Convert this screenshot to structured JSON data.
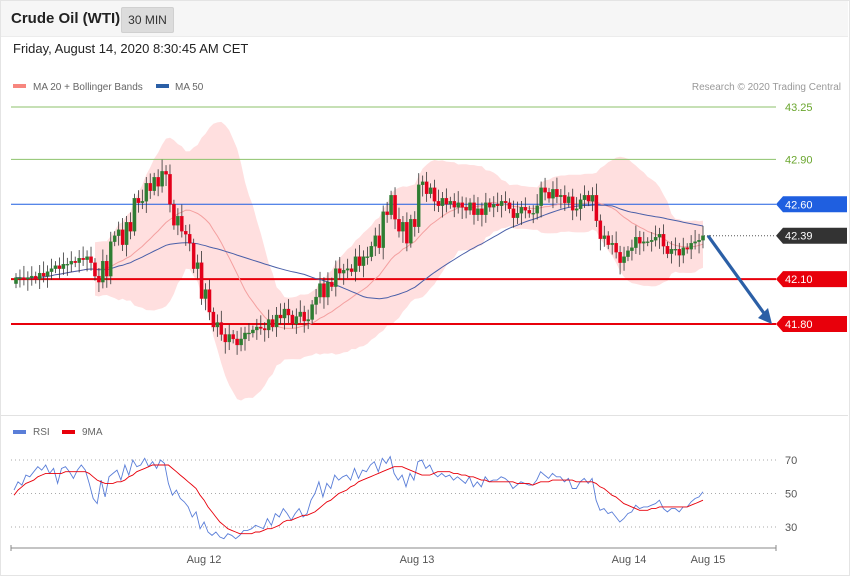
{
  "header": {
    "instrument": "Crude Oil (WTI)",
    "timeframe": "30 MIN",
    "datetime": "Friday, August 14, 2020 8:30:45 AM CET"
  },
  "legend": {
    "ma20": "MA 20 + Bollinger Bands",
    "ma50": "MA 50",
    "credit": "Research © 2020 Trading Central",
    "rsi": "RSI",
    "rsi_ma": "9MA"
  },
  "colors": {
    "bullish": "#2e7d32",
    "bearish": "#e3001b",
    "bollinger_fill": "#ffdcdc",
    "ma20": "#f4a0a0",
    "ma50": "#4a5fa8",
    "resistance_green": "#8dc26b",
    "pivot_blue": "#1f5fe0",
    "support_red": "#e8000b",
    "current_price": "#333333",
    "arrow": "#2b5fa6",
    "rsi": "#5a7ed8",
    "rsi_ma": "#e8000b"
  },
  "chart_data": [
    {
      "type": "candlestick",
      "title": "",
      "price_levels": [
        {
          "label": "43.25",
          "value": 43.25,
          "style": "green-line"
        },
        {
          "label": "42.90",
          "value": 42.9,
          "style": "green-line"
        },
        {
          "label": "42.60",
          "value": 42.6,
          "style": "blue-line"
        },
        {
          "label": "42.39",
          "value": 42.39,
          "style": "current-price"
        },
        {
          "label": "42.10",
          "value": 42.1,
          "style": "red-line"
        },
        {
          "label": "41.80",
          "value": 41.8,
          "style": "red-line"
        }
      ],
      "x_ticks": [
        "Aug 12",
        "Aug 13",
        "Aug 14",
        "Aug 15"
      ],
      "close_series": [
        42.11,
        42.11,
        42.1,
        42.11,
        42.12,
        42.1,
        42.14,
        42.12,
        42.15,
        42.17,
        42.19,
        42.17,
        42.2,
        42.2,
        42.22,
        42.21,
        42.24,
        42.23,
        42.25,
        42.21,
        42.12,
        42.08,
        42.22,
        42.12,
        42.35,
        42.39,
        42.43,
        42.33,
        42.48,
        42.42,
        42.64,
        42.61,
        42.62,
        42.74,
        42.69,
        42.78,
        42.72,
        42.82,
        42.8,
        42.6,
        42.46,
        42.52,
        42.42,
        42.4,
        42.34,
        42.17,
        42.21,
        41.97,
        42.03,
        41.88,
        41.78,
        41.81,
        41.73,
        41.68,
        41.73,
        41.7,
        41.66,
        41.7,
        41.74,
        41.74,
        41.76,
        41.78,
        41.77,
        41.76,
        41.83,
        41.78,
        41.86,
        41.84,
        41.9,
        41.86,
        41.8,
        41.85,
        41.88,
        41.82,
        41.83,
        41.93,
        41.98,
        42.07,
        41.98,
        42.08,
        42.05,
        42.17,
        42.14,
        42.16,
        42.17,
        42.15,
        42.25,
        42.19,
        42.25,
        42.25,
        42.32,
        42.39,
        42.31,
        42.55,
        42.53,
        42.66,
        42.5,
        42.42,
        42.48,
        42.34,
        42.5,
        42.45,
        42.73,
        42.75,
        42.67,
        42.71,
        42.62,
        42.59,
        42.64,
        42.6,
        42.62,
        42.58,
        42.61,
        42.58,
        42.56,
        42.61,
        42.53,
        42.57,
        42.53,
        42.61,
        42.58,
        42.6,
        42.59,
        42.62,
        42.61,
        42.57,
        42.51,
        42.54,
        42.58,
        42.56,
        42.54,
        42.54,
        42.59,
        42.71,
        42.68,
        42.64,
        42.7,
        42.65,
        42.66,
        42.61,
        42.65,
        42.56,
        42.57,
        42.63,
        42.66,
        42.62,
        42.66,
        42.49,
        42.37,
        42.39,
        42.33,
        42.34,
        42.28,
        42.21,
        42.25,
        42.29,
        42.31,
        42.38,
        42.34,
        42.35,
        42.35,
        42.36,
        42.38,
        42.4,
        42.32,
        42.27,
        42.3,
        42.3,
        42.26,
        42.31,
        42.3,
        42.34,
        42.35,
        42.36,
        42.39
      ],
      "open_series": [
        42.07,
        42.11,
        42.11,
        42.1,
        42.11,
        42.12,
        42.1,
        42.14,
        42.12,
        42.15,
        42.17,
        42.19,
        42.17,
        42.2,
        42.2,
        42.22,
        42.21,
        42.24,
        42.23,
        42.25,
        42.21,
        42.12,
        42.08,
        42.22,
        42.12,
        42.35,
        42.39,
        42.43,
        42.33,
        42.48,
        42.42,
        42.64,
        42.61,
        42.62,
        42.74,
        42.69,
        42.78,
        42.72,
        42.82,
        42.8,
        42.6,
        42.46,
        42.52,
        42.42,
        42.4,
        42.34,
        42.17,
        42.21,
        41.97,
        42.03,
        41.88,
        41.78,
        41.81,
        41.73,
        41.68,
        41.73,
        41.7,
        41.66,
        41.7,
        41.74,
        41.74,
        41.76,
        41.78,
        41.77,
        41.76,
        41.83,
        41.78,
        41.86,
        41.84,
        41.9,
        41.86,
        41.8,
        41.85,
        41.88,
        41.82,
        41.83,
        41.93,
        41.98,
        42.07,
        41.98,
        42.08,
        42.05,
        42.17,
        42.14,
        42.16,
        42.17,
        42.15,
        42.25,
        42.19,
        42.25,
        42.25,
        42.32,
        42.39,
        42.31,
        42.55,
        42.53,
        42.66,
        42.5,
        42.42,
        42.48,
        42.34,
        42.5,
        42.45,
        42.73,
        42.75,
        42.67,
        42.71,
        42.62,
        42.59,
        42.64,
        42.6,
        42.62,
        42.58,
        42.61,
        42.58,
        42.56,
        42.61,
        42.53,
        42.57,
        42.53,
        42.61,
        42.58,
        42.6,
        42.59,
        42.62,
        42.61,
        42.57,
        42.51,
        42.54,
        42.58,
        42.56,
        42.54,
        42.54,
        42.59,
        42.71,
        42.68,
        42.64,
        42.7,
        42.65,
        42.66,
        42.61,
        42.65,
        42.56,
        42.57,
        42.63,
        42.66,
        42.62,
        42.66,
        42.49,
        42.37,
        42.39,
        42.33,
        42.34,
        42.28,
        42.21,
        42.25,
        42.29,
        42.31,
        42.38,
        42.34,
        42.35,
        42.35,
        42.36,
        42.38,
        42.4,
        42.32,
        42.27,
        42.3,
        42.3,
        42.26,
        42.31,
        42.3,
        42.34,
        42.35,
        42.36
      ],
      "rsi": {
        "levels": [
          70,
          50,
          30
        ],
        "rsi_values": [
          52,
          57,
          55,
          61,
          60,
          63,
          66,
          64,
          67,
          62,
          65,
          56,
          65,
          66,
          63,
          59,
          64,
          67,
          64,
          56,
          47,
          44,
          58,
          48,
          60,
          62,
          64,
          58,
          67,
          61,
          70,
          66,
          67,
          71,
          66,
          69,
          65,
          70,
          68,
          56,
          49,
          52,
          47,
          45,
          42,
          36,
          39,
          29,
          33,
          27,
          25,
          27,
          24,
          23,
          26,
          25,
          23,
          25,
          28,
          28,
          29,
          31,
          30,
          29,
          35,
          31,
          38,
          36,
          41,
          38,
          34,
          38,
          41,
          36,
          38,
          46,
          50,
          57,
          48,
          56,
          53,
          61,
          58,
          60,
          61,
          58,
          65,
          59,
          64,
          63,
          67,
          69,
          63,
          71,
          68,
          72,
          62,
          58,
          61,
          54,
          62,
          58,
          69,
          70,
          65,
          67,
          62,
          60,
          62,
          60,
          61,
          58,
          60,
          58,
          56,
          60,
          54,
          57,
          54,
          60,
          57,
          58,
          58,
          60,
          59,
          57,
          53,
          55,
          57,
          56,
          55,
          55,
          58,
          63,
          61,
          59,
          62,
          60,
          60,
          57,
          59,
          53,
          53,
          57,
          59,
          56,
          59,
          46,
          40,
          41,
          38,
          39,
          36,
          33,
          35,
          38,
          39,
          43,
          41,
          42,
          42,
          43,
          44,
          46,
          41,
          39,
          41,
          41,
          39,
          42,
          42,
          45,
          47,
          48,
          51
        ],
        "ma_values": [
          49,
          52,
          54,
          56,
          57,
          58,
          60,
          61,
          62,
          62,
          62,
          62,
          62,
          63,
          63,
          63,
          63,
          63,
          63,
          62,
          60,
          58,
          57,
          56,
          56,
          56,
          57,
          57,
          58,
          60,
          61,
          63,
          64,
          65,
          66,
          67,
          67,
          67,
          67,
          67,
          65,
          63,
          61,
          59,
          57,
          55,
          53,
          49,
          46,
          42,
          39,
          36,
          33,
          31,
          29,
          28,
          27,
          26,
          26,
          26,
          26,
          27,
          27,
          28,
          29,
          29,
          30,
          31,
          33,
          34,
          34,
          35,
          36,
          37,
          37,
          38,
          39,
          41,
          43,
          45,
          46,
          48,
          50,
          51,
          52,
          54,
          55,
          57,
          58,
          59,
          60,
          61,
          62,
          63,
          64,
          65,
          66,
          66,
          66,
          65,
          64,
          63,
          62,
          61,
          61,
          61,
          62,
          63,
          63,
          63,
          63,
          62,
          62,
          61,
          61,
          60,
          60,
          59,
          58,
          58,
          57,
          57,
          57,
          57,
          57,
          57,
          57,
          56,
          56,
          56,
          56,
          55,
          56,
          57,
          57,
          57,
          58,
          58,
          58,
          58,
          58,
          58,
          57,
          57,
          57,
          57,
          57,
          56,
          54,
          53,
          51,
          49,
          48,
          46,
          44,
          43,
          42,
          41,
          40,
          40,
          40,
          41,
          41,
          42,
          42,
          42,
          42,
          42,
          42,
          42,
          42,
          43,
          44,
          45,
          46
        ]
      }
    }
  ]
}
